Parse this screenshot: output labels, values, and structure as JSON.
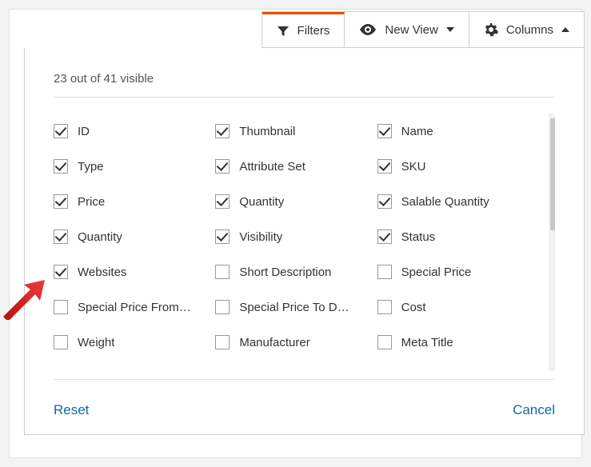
{
  "toolbar": {
    "filters_label": "Filters",
    "view_label": "New View",
    "columns_label": "Columns"
  },
  "dropdown": {
    "count_text": "23 out of 41 visible",
    "reset_label": "Reset",
    "cancel_label": "Cancel"
  },
  "columns": [
    {
      "label": "ID",
      "checked": true
    },
    {
      "label": "Thumbnail",
      "checked": true
    },
    {
      "label": "Name",
      "checked": true
    },
    {
      "label": "Type",
      "checked": true
    },
    {
      "label": "Attribute Set",
      "checked": true
    },
    {
      "label": "SKU",
      "checked": true
    },
    {
      "label": "Price",
      "checked": true
    },
    {
      "label": "Quantity",
      "checked": true
    },
    {
      "label": "Salable Quantity",
      "checked": true
    },
    {
      "label": "Quantity",
      "checked": true
    },
    {
      "label": "Visibility",
      "checked": true
    },
    {
      "label": "Status",
      "checked": true
    },
    {
      "label": "Websites",
      "checked": true
    },
    {
      "label": "Short Description",
      "checked": false
    },
    {
      "label": "Special Price",
      "checked": false
    },
    {
      "label": "Special Price From…",
      "checked": false
    },
    {
      "label": "Special Price To D…",
      "checked": false
    },
    {
      "label": "Cost",
      "checked": false
    },
    {
      "label": "Weight",
      "checked": false
    },
    {
      "label": "Manufacturer",
      "checked": false
    },
    {
      "label": "Meta Title",
      "checked": false
    }
  ]
}
